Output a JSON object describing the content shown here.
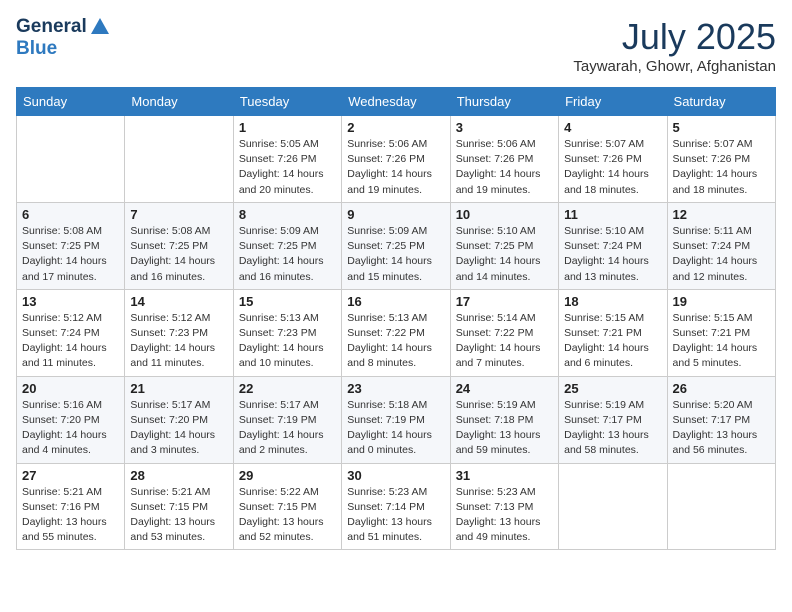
{
  "header": {
    "logo_general": "General",
    "logo_blue": "Blue",
    "month": "July 2025",
    "location": "Taywarah, Ghowr, Afghanistan"
  },
  "weekdays": [
    "Sunday",
    "Monday",
    "Tuesday",
    "Wednesday",
    "Thursday",
    "Friday",
    "Saturday"
  ],
  "weeks": [
    [
      {
        "day": "",
        "info": ""
      },
      {
        "day": "",
        "info": ""
      },
      {
        "day": "1",
        "sunrise": "Sunrise: 5:05 AM",
        "sunset": "Sunset: 7:26 PM",
        "daylight": "Daylight: 14 hours and 20 minutes."
      },
      {
        "day": "2",
        "sunrise": "Sunrise: 5:06 AM",
        "sunset": "Sunset: 7:26 PM",
        "daylight": "Daylight: 14 hours and 19 minutes."
      },
      {
        "day": "3",
        "sunrise": "Sunrise: 5:06 AM",
        "sunset": "Sunset: 7:26 PM",
        "daylight": "Daylight: 14 hours and 19 minutes."
      },
      {
        "day": "4",
        "sunrise": "Sunrise: 5:07 AM",
        "sunset": "Sunset: 7:26 PM",
        "daylight": "Daylight: 14 hours and 18 minutes."
      },
      {
        "day": "5",
        "sunrise": "Sunrise: 5:07 AM",
        "sunset": "Sunset: 7:26 PM",
        "daylight": "Daylight: 14 hours and 18 minutes."
      }
    ],
    [
      {
        "day": "6",
        "sunrise": "Sunrise: 5:08 AM",
        "sunset": "Sunset: 7:25 PM",
        "daylight": "Daylight: 14 hours and 17 minutes."
      },
      {
        "day": "7",
        "sunrise": "Sunrise: 5:08 AM",
        "sunset": "Sunset: 7:25 PM",
        "daylight": "Daylight: 14 hours and 16 minutes."
      },
      {
        "day": "8",
        "sunrise": "Sunrise: 5:09 AM",
        "sunset": "Sunset: 7:25 PM",
        "daylight": "Daylight: 14 hours and 16 minutes."
      },
      {
        "day": "9",
        "sunrise": "Sunrise: 5:09 AM",
        "sunset": "Sunset: 7:25 PM",
        "daylight": "Daylight: 14 hours and 15 minutes."
      },
      {
        "day": "10",
        "sunrise": "Sunrise: 5:10 AM",
        "sunset": "Sunset: 7:25 PM",
        "daylight": "Daylight: 14 hours and 14 minutes."
      },
      {
        "day": "11",
        "sunrise": "Sunrise: 5:10 AM",
        "sunset": "Sunset: 7:24 PM",
        "daylight": "Daylight: 14 hours and 13 minutes."
      },
      {
        "day": "12",
        "sunrise": "Sunrise: 5:11 AM",
        "sunset": "Sunset: 7:24 PM",
        "daylight": "Daylight: 14 hours and 12 minutes."
      }
    ],
    [
      {
        "day": "13",
        "sunrise": "Sunrise: 5:12 AM",
        "sunset": "Sunset: 7:24 PM",
        "daylight": "Daylight: 14 hours and 11 minutes."
      },
      {
        "day": "14",
        "sunrise": "Sunrise: 5:12 AM",
        "sunset": "Sunset: 7:23 PM",
        "daylight": "Daylight: 14 hours and 11 minutes."
      },
      {
        "day": "15",
        "sunrise": "Sunrise: 5:13 AM",
        "sunset": "Sunset: 7:23 PM",
        "daylight": "Daylight: 14 hours and 10 minutes."
      },
      {
        "day": "16",
        "sunrise": "Sunrise: 5:13 AM",
        "sunset": "Sunset: 7:22 PM",
        "daylight": "Daylight: 14 hours and 8 minutes."
      },
      {
        "day": "17",
        "sunrise": "Sunrise: 5:14 AM",
        "sunset": "Sunset: 7:22 PM",
        "daylight": "Daylight: 14 hours and 7 minutes."
      },
      {
        "day": "18",
        "sunrise": "Sunrise: 5:15 AM",
        "sunset": "Sunset: 7:21 PM",
        "daylight": "Daylight: 14 hours and 6 minutes."
      },
      {
        "day": "19",
        "sunrise": "Sunrise: 5:15 AM",
        "sunset": "Sunset: 7:21 PM",
        "daylight": "Daylight: 14 hours and 5 minutes."
      }
    ],
    [
      {
        "day": "20",
        "sunrise": "Sunrise: 5:16 AM",
        "sunset": "Sunset: 7:20 PM",
        "daylight": "Daylight: 14 hours and 4 minutes."
      },
      {
        "day": "21",
        "sunrise": "Sunrise: 5:17 AM",
        "sunset": "Sunset: 7:20 PM",
        "daylight": "Daylight: 14 hours and 3 minutes."
      },
      {
        "day": "22",
        "sunrise": "Sunrise: 5:17 AM",
        "sunset": "Sunset: 7:19 PM",
        "daylight": "Daylight: 14 hours and 2 minutes."
      },
      {
        "day": "23",
        "sunrise": "Sunrise: 5:18 AM",
        "sunset": "Sunset: 7:19 PM",
        "daylight": "Daylight: 14 hours and 0 minutes."
      },
      {
        "day": "24",
        "sunrise": "Sunrise: 5:19 AM",
        "sunset": "Sunset: 7:18 PM",
        "daylight": "Daylight: 13 hours and 59 minutes."
      },
      {
        "day": "25",
        "sunrise": "Sunrise: 5:19 AM",
        "sunset": "Sunset: 7:17 PM",
        "daylight": "Daylight: 13 hours and 58 minutes."
      },
      {
        "day": "26",
        "sunrise": "Sunrise: 5:20 AM",
        "sunset": "Sunset: 7:17 PM",
        "daylight": "Daylight: 13 hours and 56 minutes."
      }
    ],
    [
      {
        "day": "27",
        "sunrise": "Sunrise: 5:21 AM",
        "sunset": "Sunset: 7:16 PM",
        "daylight": "Daylight: 13 hours and 55 minutes."
      },
      {
        "day": "28",
        "sunrise": "Sunrise: 5:21 AM",
        "sunset": "Sunset: 7:15 PM",
        "daylight": "Daylight: 13 hours and 53 minutes."
      },
      {
        "day": "29",
        "sunrise": "Sunrise: 5:22 AM",
        "sunset": "Sunset: 7:15 PM",
        "daylight": "Daylight: 13 hours and 52 minutes."
      },
      {
        "day": "30",
        "sunrise": "Sunrise: 5:23 AM",
        "sunset": "Sunset: 7:14 PM",
        "daylight": "Daylight: 13 hours and 51 minutes."
      },
      {
        "day": "31",
        "sunrise": "Sunrise: 5:23 AM",
        "sunset": "Sunset: 7:13 PM",
        "daylight": "Daylight: 13 hours and 49 minutes."
      },
      {
        "day": "",
        "info": ""
      },
      {
        "day": "",
        "info": ""
      }
    ]
  ]
}
